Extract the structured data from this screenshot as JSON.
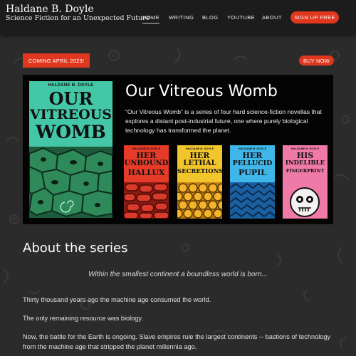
{
  "site": {
    "title": "Haldane B. Doyle",
    "tagline": "Science Fiction for an Unexpected Future"
  },
  "nav": {
    "home": "HOME",
    "writing": "WRITING",
    "blog": "BLOG",
    "youtube": "YOUTUBE",
    "about": "ABOUT",
    "signup": "SIGN UP FREE"
  },
  "feature": {
    "coming_badge": "COMING APRIL 2023!",
    "buy_now": "BUY NOW",
    "title": "Our Vitreous Womb",
    "description": "“Our Vitreous Womb” is a series of four hard science-fiction novellas that explores a distant post-industrial future, one where purely biological technology has transformed the planet.",
    "main_cover": {
      "author": "HALDANE B. DOYLE",
      "line1": "OUR",
      "line2": "VITREOUS",
      "line3": "WOMB"
    },
    "books": [
      {
        "author": "HALDANE B. DOYLE",
        "line1": "HER",
        "line2": "UNBOUND",
        "line3": "HALLUX"
      },
      {
        "author": "HALDANE B. DOYLE",
        "line1": "HER",
        "line2": "LETHAL",
        "line3": "SECRETIONS"
      },
      {
        "author": "HALDANE B. DOYLE",
        "line1": "HER",
        "line2": "PELLUCID",
        "line3": "PUPIL"
      },
      {
        "author": "HALDANE B. DOYLE",
        "line1": "HIS",
        "line2": "INDELIBLE",
        "line3": "FINGERPRINT"
      }
    ]
  },
  "about": {
    "heading": "About the series",
    "quote": "Within the smallest continent a boundless world is born...",
    "p1": "Thirty thousand years ago the machine age consumed the world.",
    "p2": "The only remaining resource was biology.",
    "p3": "Now, the battle for the Earth is ongoing. Slave empires rule the largest continents -- bastions of technology from the machine age that stripped the planet millennia ago."
  },
  "colors": {
    "accent": "#e0371f",
    "background": "#2b2b2b",
    "header": "#1c1c1c",
    "main_cover": "#44c7a6"
  }
}
